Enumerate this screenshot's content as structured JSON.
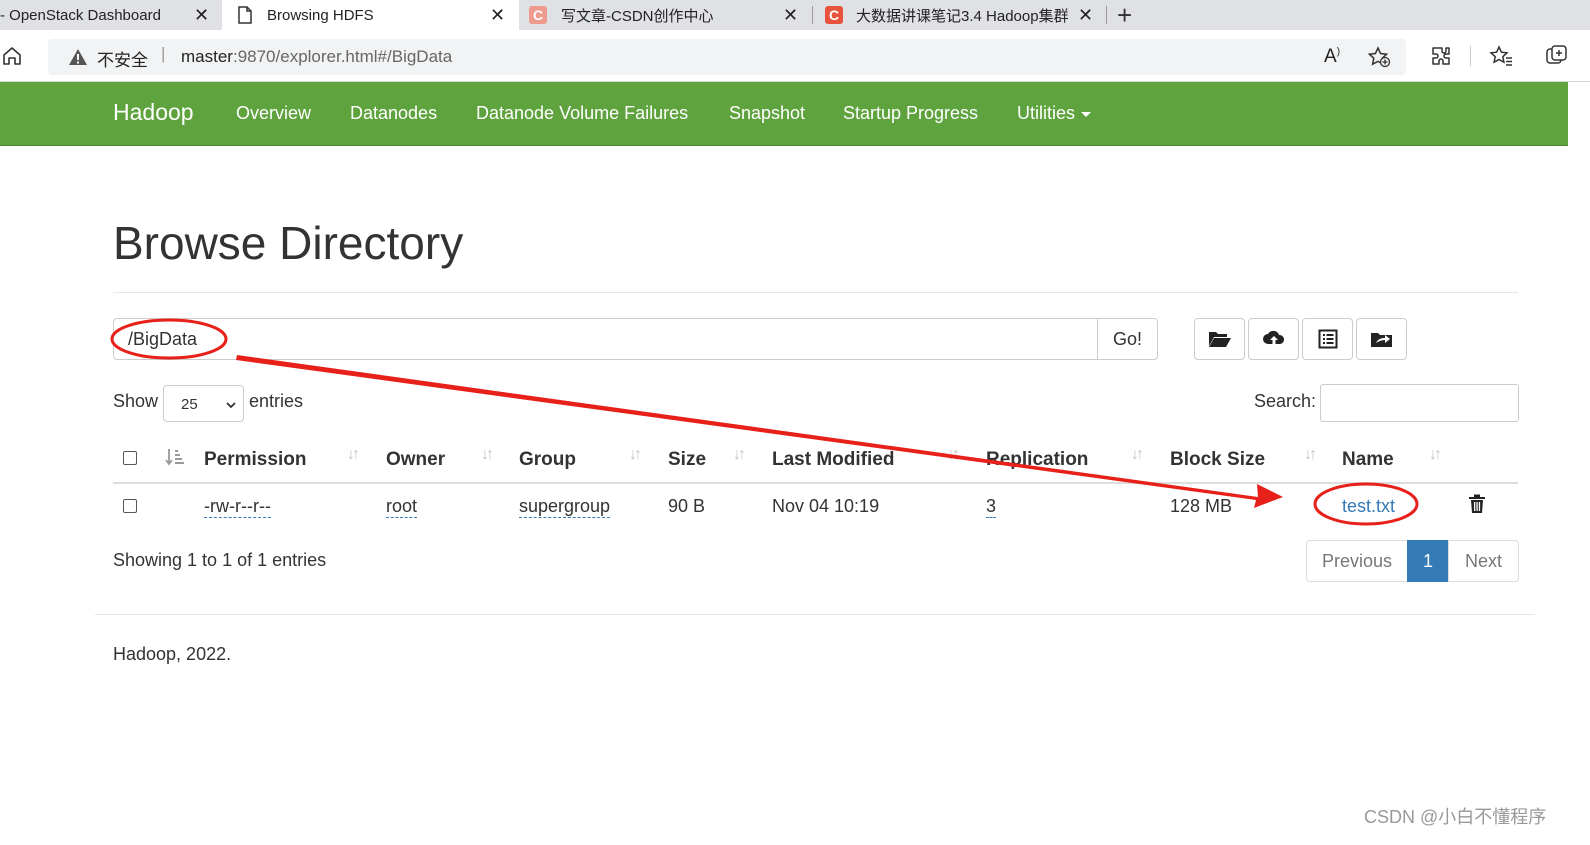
{
  "browser": {
    "tabs": [
      {
        "title": "- OpenStack Dashboard",
        "close": "✕"
      },
      {
        "title": "Browsing HDFS",
        "close": "✕"
      },
      {
        "title": "写文章-CSDN创作中心",
        "close": "✕"
      },
      {
        "title": "大数据讲课笔记3.4 Hadoop集群",
        "close": "✕"
      }
    ],
    "new_tab": "+",
    "security_label": "不安全",
    "url_host": "master",
    "url_rest": ":9870/explorer.html#/BigData"
  },
  "navbar": {
    "brand": "Hadoop",
    "items": [
      "Overview",
      "Datanodes",
      "Datanode Volume Failures",
      "Snapshot",
      "Startup Progress",
      "Utilities"
    ]
  },
  "page": {
    "title": "Browse Directory",
    "path_value": "/BigData",
    "go_label": "Go!",
    "show_label": "Show",
    "entries_label": "entries",
    "page_length": "25",
    "search_label": "Search:"
  },
  "table": {
    "headers": [
      "Permission",
      "Owner",
      "Group",
      "Size",
      "Last Modified",
      "Replication",
      "Block Size",
      "Name"
    ],
    "rows": [
      {
        "permission": "-rw-r--r--",
        "owner": "root",
        "group": "supergroup",
        "size": "90 B",
        "last_modified": "Nov 04 10:19",
        "replication": "3",
        "block_size": "128 MB",
        "name": "test.txt"
      }
    ]
  },
  "pagination": {
    "info": "Showing 1 to 1 of 1 entries",
    "previous": "Previous",
    "current": "1",
    "next": "Next"
  },
  "footer": "Hadoop, 2022.",
  "watermark": "CSDN @小白不懂程序",
  "colors": {
    "navbar": "#5fa33e",
    "link": "#337ab7",
    "annotation": "#e8201a"
  }
}
